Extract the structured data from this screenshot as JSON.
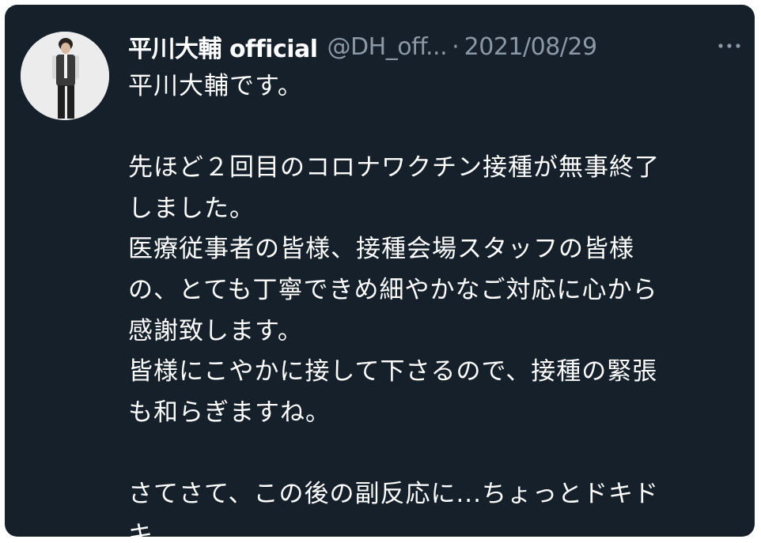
{
  "tweet": {
    "author": {
      "display_name": "平川大輔 official",
      "handle": "@DH_off...",
      "separator": "·",
      "date": "2021/08/29",
      "avatar_icon": "avatar-photo-icon"
    },
    "more_icon": "more-dots-icon",
    "lines": [
      "平川大輔です。",
      "",
      "先ほど２回目のコロナワクチン接種が無事終了",
      "しました。",
      "医療従事者の皆様、接種会場スタッフの皆様",
      "の、とても丁寧できめ細やかなご対応に心から",
      "感謝致します。",
      "皆様にこやかに接して下さるので、接種の緊張",
      "も和らぎますね。",
      "",
      "さてさて、この後の副反応に...ちょっとドキド",
      "キ..."
    ]
  },
  "colors": {
    "background": "#15202b",
    "text_primary": "#ffffff",
    "text_secondary": "#8b98a5"
  }
}
